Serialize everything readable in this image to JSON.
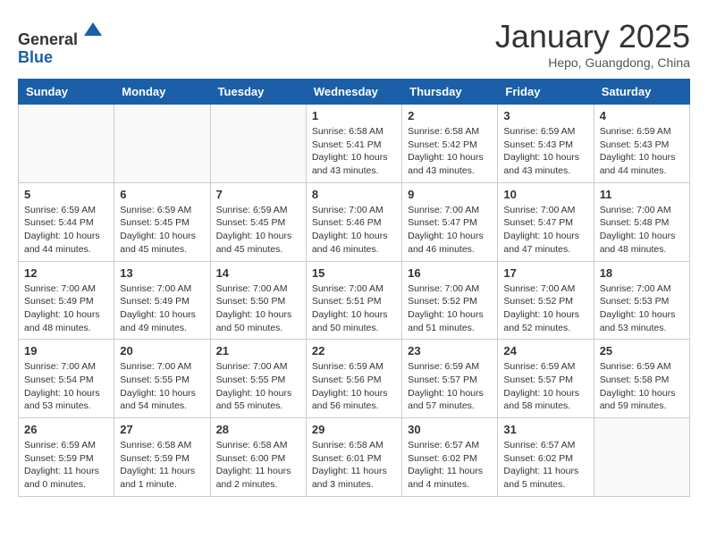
{
  "header": {
    "logo_line1": "General",
    "logo_line2": "Blue",
    "month_title": "January 2025",
    "location": "Hepo, Guangdong, China"
  },
  "weekdays": [
    "Sunday",
    "Monday",
    "Tuesday",
    "Wednesday",
    "Thursday",
    "Friday",
    "Saturday"
  ],
  "weeks": [
    [
      {
        "day": "",
        "detail": ""
      },
      {
        "day": "",
        "detail": ""
      },
      {
        "day": "",
        "detail": ""
      },
      {
        "day": "1",
        "detail": "Sunrise: 6:58 AM\nSunset: 5:41 PM\nDaylight: 10 hours\nand 43 minutes."
      },
      {
        "day": "2",
        "detail": "Sunrise: 6:58 AM\nSunset: 5:42 PM\nDaylight: 10 hours\nand 43 minutes."
      },
      {
        "day": "3",
        "detail": "Sunrise: 6:59 AM\nSunset: 5:43 PM\nDaylight: 10 hours\nand 43 minutes."
      },
      {
        "day": "4",
        "detail": "Sunrise: 6:59 AM\nSunset: 5:43 PM\nDaylight: 10 hours\nand 44 minutes."
      }
    ],
    [
      {
        "day": "5",
        "detail": "Sunrise: 6:59 AM\nSunset: 5:44 PM\nDaylight: 10 hours\nand 44 minutes."
      },
      {
        "day": "6",
        "detail": "Sunrise: 6:59 AM\nSunset: 5:45 PM\nDaylight: 10 hours\nand 45 minutes."
      },
      {
        "day": "7",
        "detail": "Sunrise: 6:59 AM\nSunset: 5:45 PM\nDaylight: 10 hours\nand 45 minutes."
      },
      {
        "day": "8",
        "detail": "Sunrise: 7:00 AM\nSunset: 5:46 PM\nDaylight: 10 hours\nand 46 minutes."
      },
      {
        "day": "9",
        "detail": "Sunrise: 7:00 AM\nSunset: 5:47 PM\nDaylight: 10 hours\nand 46 minutes."
      },
      {
        "day": "10",
        "detail": "Sunrise: 7:00 AM\nSunset: 5:47 PM\nDaylight: 10 hours\nand 47 minutes."
      },
      {
        "day": "11",
        "detail": "Sunrise: 7:00 AM\nSunset: 5:48 PM\nDaylight: 10 hours\nand 48 minutes."
      }
    ],
    [
      {
        "day": "12",
        "detail": "Sunrise: 7:00 AM\nSunset: 5:49 PM\nDaylight: 10 hours\nand 48 minutes."
      },
      {
        "day": "13",
        "detail": "Sunrise: 7:00 AM\nSunset: 5:49 PM\nDaylight: 10 hours\nand 49 minutes."
      },
      {
        "day": "14",
        "detail": "Sunrise: 7:00 AM\nSunset: 5:50 PM\nDaylight: 10 hours\nand 50 minutes."
      },
      {
        "day": "15",
        "detail": "Sunrise: 7:00 AM\nSunset: 5:51 PM\nDaylight: 10 hours\nand 50 minutes."
      },
      {
        "day": "16",
        "detail": "Sunrise: 7:00 AM\nSunset: 5:52 PM\nDaylight: 10 hours\nand 51 minutes."
      },
      {
        "day": "17",
        "detail": "Sunrise: 7:00 AM\nSunset: 5:52 PM\nDaylight: 10 hours\nand 52 minutes."
      },
      {
        "day": "18",
        "detail": "Sunrise: 7:00 AM\nSunset: 5:53 PM\nDaylight: 10 hours\nand 53 minutes."
      }
    ],
    [
      {
        "day": "19",
        "detail": "Sunrise: 7:00 AM\nSunset: 5:54 PM\nDaylight: 10 hours\nand 53 minutes."
      },
      {
        "day": "20",
        "detail": "Sunrise: 7:00 AM\nSunset: 5:55 PM\nDaylight: 10 hours\nand 54 minutes."
      },
      {
        "day": "21",
        "detail": "Sunrise: 7:00 AM\nSunset: 5:55 PM\nDaylight: 10 hours\nand 55 minutes."
      },
      {
        "day": "22",
        "detail": "Sunrise: 6:59 AM\nSunset: 5:56 PM\nDaylight: 10 hours\nand 56 minutes."
      },
      {
        "day": "23",
        "detail": "Sunrise: 6:59 AM\nSunset: 5:57 PM\nDaylight: 10 hours\nand 57 minutes."
      },
      {
        "day": "24",
        "detail": "Sunrise: 6:59 AM\nSunset: 5:57 PM\nDaylight: 10 hours\nand 58 minutes."
      },
      {
        "day": "25",
        "detail": "Sunrise: 6:59 AM\nSunset: 5:58 PM\nDaylight: 10 hours\nand 59 minutes."
      }
    ],
    [
      {
        "day": "26",
        "detail": "Sunrise: 6:59 AM\nSunset: 5:59 PM\nDaylight: 11 hours\nand 0 minutes."
      },
      {
        "day": "27",
        "detail": "Sunrise: 6:58 AM\nSunset: 5:59 PM\nDaylight: 11 hours\nand 1 minute."
      },
      {
        "day": "28",
        "detail": "Sunrise: 6:58 AM\nSunset: 6:00 PM\nDaylight: 11 hours\nand 2 minutes."
      },
      {
        "day": "29",
        "detail": "Sunrise: 6:58 AM\nSunset: 6:01 PM\nDaylight: 11 hours\nand 3 minutes."
      },
      {
        "day": "30",
        "detail": "Sunrise: 6:57 AM\nSunset: 6:02 PM\nDaylight: 11 hours\nand 4 minutes."
      },
      {
        "day": "31",
        "detail": "Sunrise: 6:57 AM\nSunset: 6:02 PM\nDaylight: 11 hours\nand 5 minutes."
      },
      {
        "day": "",
        "detail": ""
      }
    ]
  ]
}
